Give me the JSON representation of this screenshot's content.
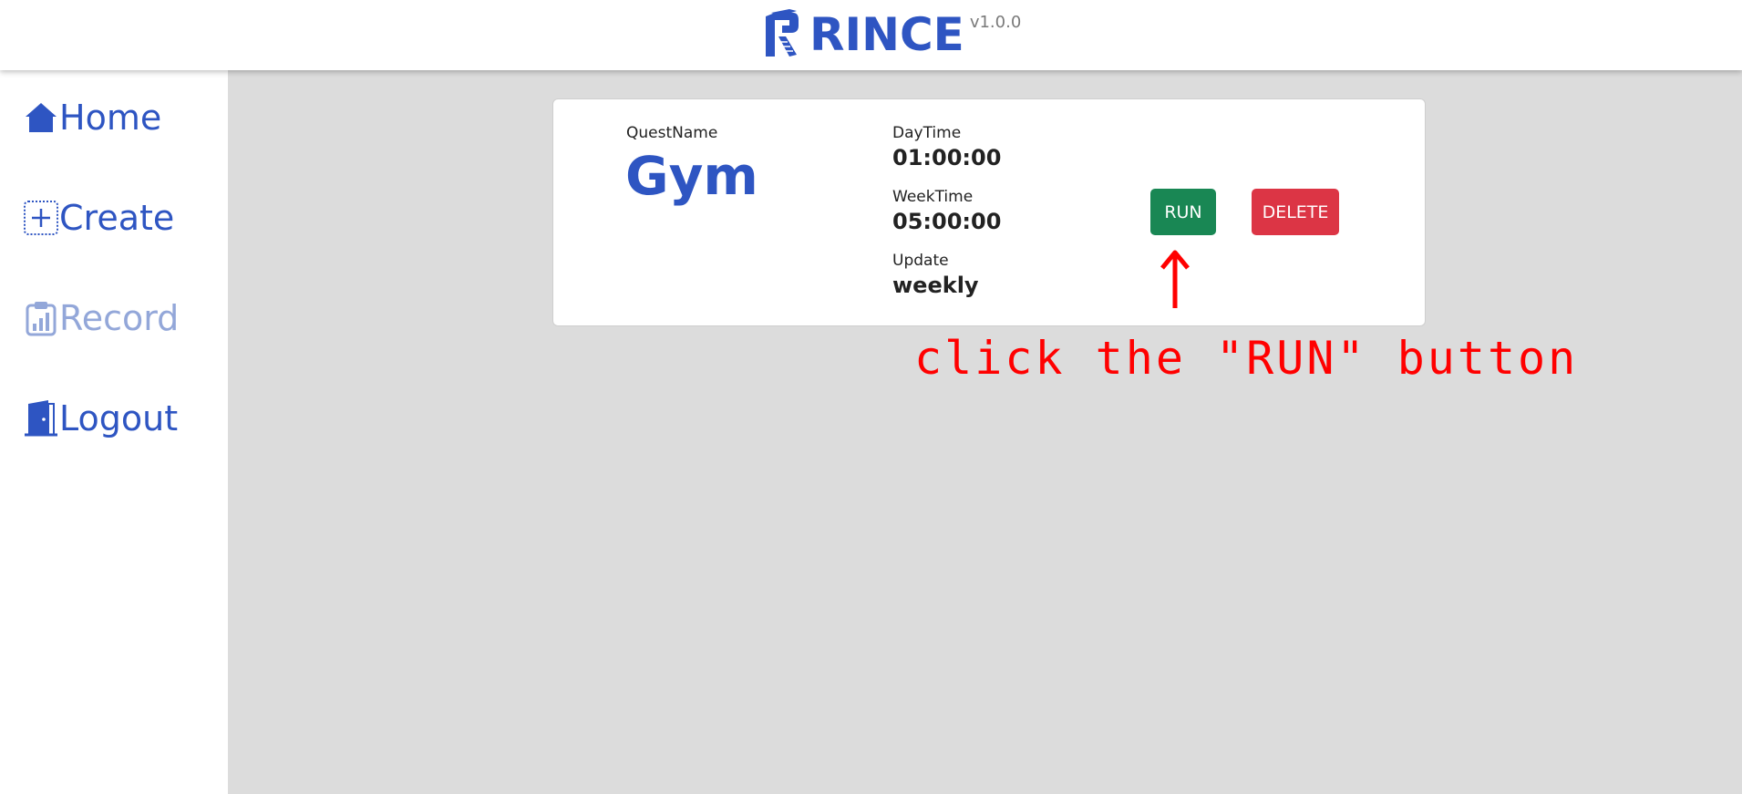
{
  "header": {
    "logo_icon": "rince-logo-icon",
    "brand": "RINCE",
    "version": "v1.0.0"
  },
  "sidebar": {
    "items": [
      {
        "label": "Home",
        "icon": "house-icon"
      },
      {
        "label": "Create",
        "icon": "plus-square-icon"
      },
      {
        "label": "Record",
        "icon": "clipboard-chart-icon"
      },
      {
        "label": "Logout",
        "icon": "door-icon"
      }
    ]
  },
  "quest": {
    "name_label": "QuestName",
    "name": "Gym",
    "daytime_label": "DayTime",
    "daytime": "01:00:00",
    "weektime_label": "WeekTime",
    "weektime": "05:00:00",
    "update_label": "Update",
    "update": "weekly",
    "run_label": "RUN",
    "delete_label": "DELETE"
  },
  "annotation": {
    "text": "click the \"RUN\" button",
    "arrow_icon": "up-arrow-icon"
  },
  "colors": {
    "brand": "#2e55c2",
    "muted": "#93a7d9",
    "run": "#198754",
    "delete": "#dc3545",
    "annotation": "#ff0000",
    "background": "#dcdcdc"
  }
}
